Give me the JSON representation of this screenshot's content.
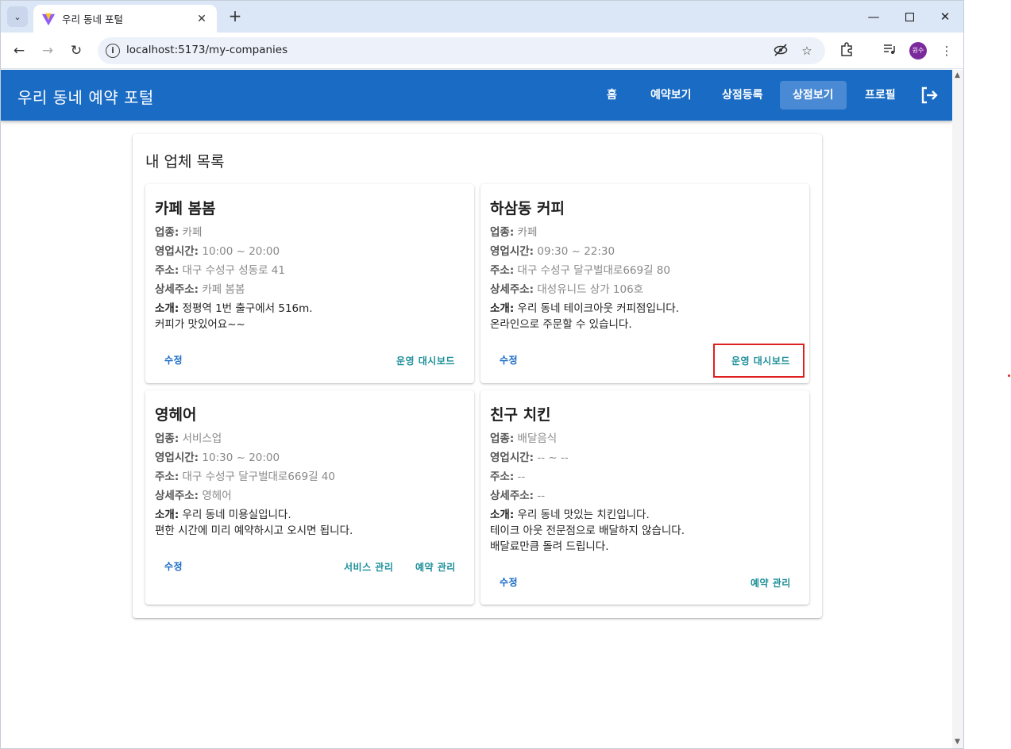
{
  "browser": {
    "tab_title": "우리 동네 포털",
    "url": "localhost:5173/my-companies",
    "profile_initial": "원수"
  },
  "appbar": {
    "title": "우리 동네 예약 포털",
    "nav": [
      "홈",
      "예약보기",
      "상점등록",
      "상점보기",
      "프로필"
    ],
    "active_nav": "상점보기"
  },
  "page": {
    "title": "내 업체 목록"
  },
  "labels": {
    "category": "업종:",
    "hours": "영업시간:",
    "address": "주소:",
    "detail_address": "상세주소:",
    "intro": "소개:",
    "edit": "수정"
  },
  "companies": [
    {
      "name": "카페 봄봄",
      "category": "카페",
      "hours": "10:00 ~ 20:00",
      "address": "대구 수성구 성동로 41",
      "detail_address": "카페 봄봄",
      "intro_lines": [
        "정평역 1번 출구에서 516m.",
        "커피가 맛있어요~~"
      ],
      "actions": [
        "운영 대시보드"
      ]
    },
    {
      "name": "하삼동 커피",
      "category": "카페",
      "hours": "09:30 ~ 22:30",
      "address": "대구 수성구 달구벌대로669길 80",
      "detail_address": "대성유니드 상가 106호",
      "intro_lines": [
        "우리 동네 테이크아웃 커피점입니다.",
        "온라인으로 주문할 수 있습니다."
      ],
      "actions": [
        "운영 대시보드"
      ]
    },
    {
      "name": "영헤어",
      "category": "서비스업",
      "hours": "10:30 ~ 20:00",
      "address": "대구 수성구 달구벌대로669길 40",
      "detail_address": "영헤어",
      "intro_lines": [
        "우리 동네 미용실입니다.",
        "편한 시간에 미리 예약하시고 오시면 됩니다."
      ],
      "actions": [
        "서비스 관리",
        "예약 관리"
      ]
    },
    {
      "name": "친구 치킨",
      "category": "배달음식",
      "hours": "-- ~ --",
      "address": "--",
      "detail_address": "--",
      "intro_lines": [
        "우리 동네 맛있는 치킨입니다.",
        "테이크 아웃 전문점으로 배달하지 않습니다.",
        "배달료만큼 돌려 드립니다."
      ],
      "actions": [
        "예약 관리"
      ]
    }
  ]
}
